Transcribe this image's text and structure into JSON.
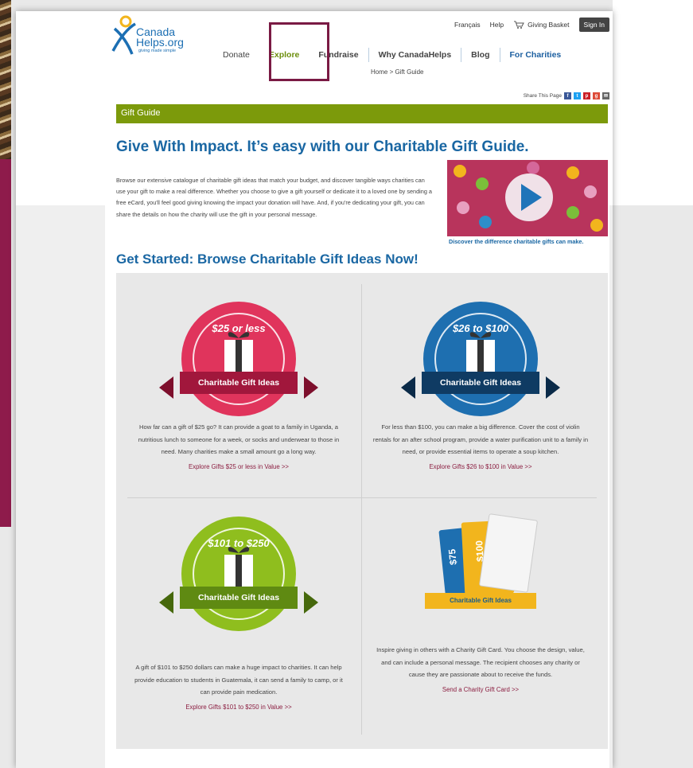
{
  "header": {
    "logo_line1": "Canada",
    "logo_line2": "Helps.org",
    "logo_tagline": "giving made simple",
    "utility": {
      "language": "Français",
      "help": "Help",
      "basket": "Giving Basket",
      "signin": "Sign In"
    },
    "nav": [
      "Donate",
      "Explore",
      "Fundraise",
      "Why CanadaHelps",
      "Blog",
      "For Charities"
    ],
    "breadcrumb": "Home  >  Gift Guide",
    "share_label": "Share This Page"
  },
  "section_bar": "Gift Guide",
  "title": "Give With Impact. It’s easy with our Charitable Gift Guide.",
  "intro": "Browse our extensive catalogue of charitable gift ideas that match your budget, and discover tangible ways charities can use your gift to make a real difference.  Whether you choose to give a gift yourself or dedicate it to a loved one by sending a free eCard, you'll feel good giving knowing the impact your donation will have. And, if you're dedicating your gift, you can share the details on how the charity will use the gift in your personal message.",
  "video_caption": "Discover the difference charitable gifts can make.",
  "subtitle": "Get Started: Browse Charitable Gift Ideas Now!",
  "tiles": [
    {
      "price": "$25 or less",
      "ribbon": "Charitable Gift Ideas",
      "text": "How far can a gift of $25 go? It can provide a goat to a family in Uganda, a nutritious lunch to someone for a week, or socks and underwear to those in need. Many charities make a small amount go a long way.",
      "link": "Explore Gifts $25 or less in Value >>",
      "color": "#e0345c",
      "ribbon_color": "#a1173c"
    },
    {
      "price": "$26 to $100",
      "ribbon": "Charitable Gift Ideas",
      "text": "For less than $100, you can make a big difference. Cover the cost of violin rentals for an after school program, provide a water purification unit to a family in need, or provide essential items to operate a soup kitchen.",
      "link": "Explore Gifts $26 to $100 in Value >>",
      "color": "#1e6fb0",
      "ribbon_color": "#0f3b63"
    },
    {
      "price": "$101 to $250",
      "ribbon": "Charitable Gift Ideas",
      "text": "A gift of $101 to $250 dollars can make a huge impact to charities. It can help provide education to students in Guatemala, it can send a family to camp, or it can provide pain medication.",
      "link": "Explore Gifts $101 to $250 in Value >>",
      "color": "#8fbe1e",
      "ribbon_color": "#5f8a12"
    },
    {
      "ribbon": "Charitable Gift Ideas",
      "card_labels": [
        "$75",
        "$100"
      ],
      "text": "Inspire giving in others with a Charity Gift Card. You choose the design, value, and can include a personal message. The recipient chooses any charity or cause they are passionate about to receive the funds.",
      "link": "Send a Charity Gift Card >>"
    }
  ]
}
